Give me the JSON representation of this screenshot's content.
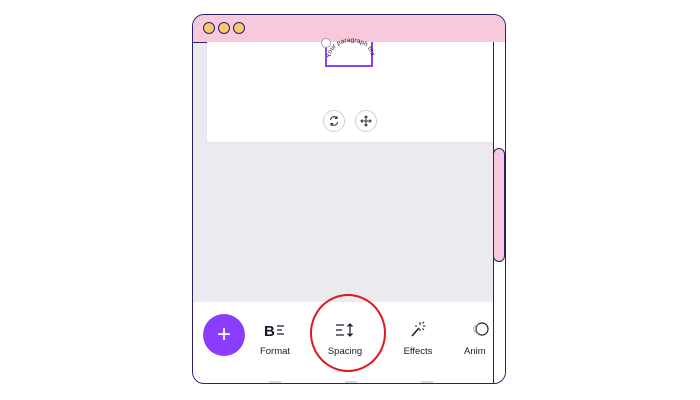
{
  "canvas": {
    "curved_text": "Your paragraph text",
    "rotate_icon": "rotate-icon",
    "move_icon": "move-icon"
  },
  "toolbar": {
    "add_icon": "plus-icon",
    "add_label": "+",
    "tools": [
      {
        "label": "Format",
        "icon": "bold-format-icon"
      },
      {
        "label": "Spacing",
        "icon": "spacing-icon"
      },
      {
        "label": "Effects",
        "icon": "magic-wand-icon"
      },
      {
        "label": "Anim",
        "icon": "animate-icon"
      }
    ]
  },
  "colors": {
    "accent": "#8b3dff",
    "titlebar": "#f8c9dc",
    "window_border": "#2a1f6b",
    "annotation": "#e0181f",
    "traffic_dot": "#f7c96c"
  }
}
